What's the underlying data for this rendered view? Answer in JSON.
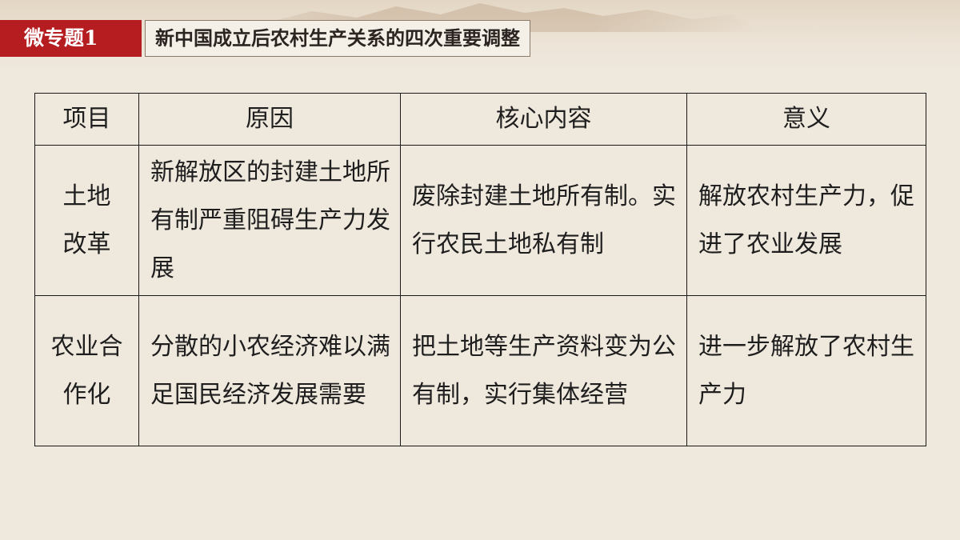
{
  "title": {
    "tag": "微专题1",
    "text": "新中国成立后农村生产关系的四次重要调整"
  },
  "table": {
    "headers": [
      "项目",
      "原因",
      "核心内容",
      "意义"
    ],
    "rows": [
      {
        "item": [
          "土地",
          "改革"
        ],
        "reason": "新解放区的封建土地所有制严重阻碍生产力发展",
        "content": "废除封建土地所有制。实行农民土地私有制",
        "significance": "解放农村生产力，促进了农业发展"
      },
      {
        "item": [
          "农业合",
          "作化"
        ],
        "reason": "分散的小农经济难以满足国民经济发展需要",
        "content": "把土地等生产资料变为公有制，实行集体经营",
        "significance": "进一步解放了农村生产力"
      }
    ]
  }
}
